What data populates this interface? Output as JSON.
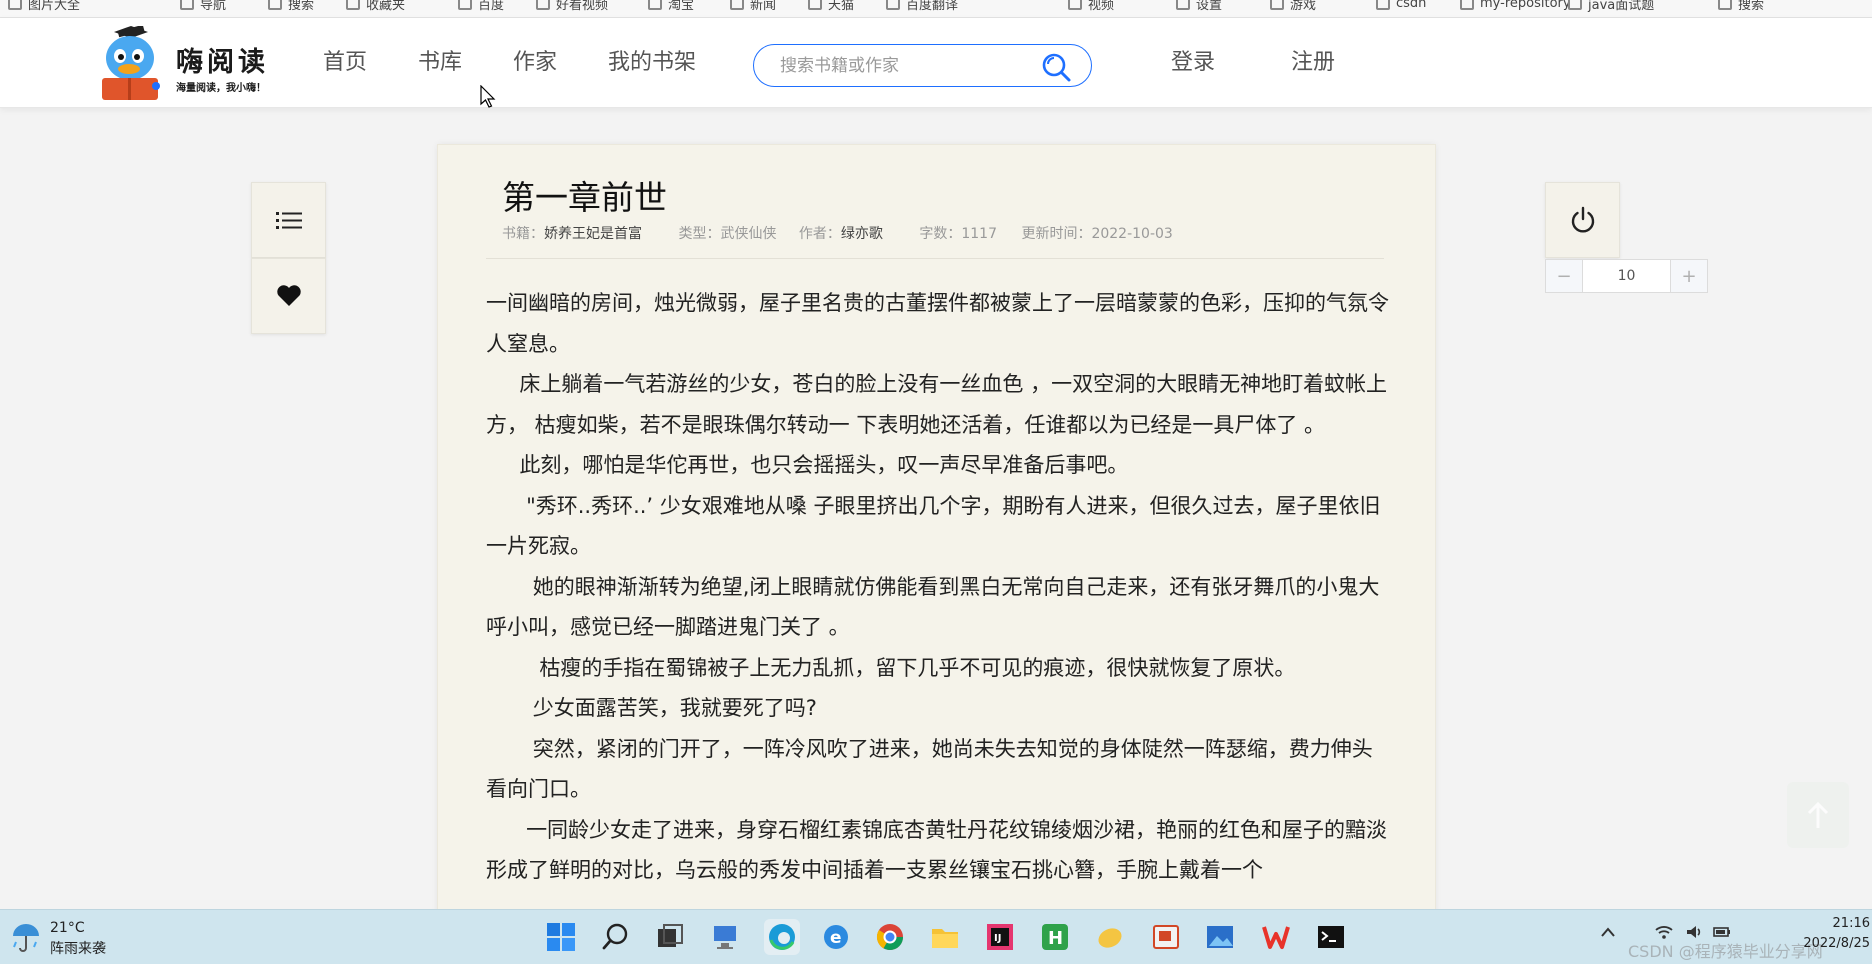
{
  "bookmarks": [
    "图片大全",
    "导航",
    "搜索",
    "收藏夹",
    "百度",
    "好看视频",
    "淘宝",
    "新闻",
    "天猫",
    "百度翻译",
    "视频",
    "设置",
    "游戏",
    "csdn",
    "my-repository",
    "java面试题",
    "搜索"
  ],
  "header": {
    "brand": "嗨阅读",
    "slogan": "海量阅读，我小嗨！",
    "nav": [
      "首页",
      "书库",
      "作家",
      "我的书架"
    ],
    "search_placeholder": "搜索书籍或作家",
    "login": "登录",
    "register": "注册"
  },
  "chapter": {
    "title": "第一章前世",
    "meta": {
      "book_label": "书籍：",
      "book": "娇养王妃是首富",
      "type_label": "类型：",
      "type": "武侠仙侠",
      "author_label": "作者：",
      "author": "绿亦歌",
      "words_label": "字数：",
      "words": "1117",
      "updated_label": "更新时间：",
      "updated": "2022-10-03"
    },
    "paragraphs": [
      "一间幽暗的房间，烛光微弱，屋子里名贵的古董摆件都被蒙上了一层暗蒙蒙的色彩，压抑的气氛令人窒息。",
      "     床上躺着一气若游丝的少女，苍白的脸上没有一丝血色 ，一双空洞的大眼睛无神地盯着蚊帐上方， 枯瘦如柴，若不是眼珠偶尔转动一 下表明她还活着，任谁都以为已经是一具尸体了 。",
      "     此刻，哪怕是华佗再世，也只会摇摇头，叹一声尽早准备后事吧。",
      "      \"秀环..秀环..’ 少女艰难地从嗓 子眼里挤出几个字，期盼有人进来，但很久过去，屋子里依旧一片死寂。",
      "       她的眼神渐渐转为绝望,闭上眼睛就仿佛能看到黑白无常向自己走来，还有张牙舞爪的小鬼大呼小叫，感觉已经一脚踏进鬼门关了 。",
      "        枯瘦的手指在蜀锦被子上无力乱抓，留下几乎不可见的痕迹，很快就恢复了原状。",
      "       少女面露苦笑，我就要死了吗?",
      "       突然，紧闭的门开了，一阵冷风吹了进来，她尚未失去知觉的身体陡然一阵瑟缩，费力伸头看向门口。",
      "      一同龄少女走了进来，身穿石榴红素锦底杏黄牡丹花纹锦绫烟沙裙，艳丽的红色和屋子的黯淡形成了鲜明的对比，乌云般的秀发中间插着一支累丝镶宝石挑心簪，手腕上戴着一个"
    ]
  },
  "reader_controls": {
    "font_size": "10",
    "minus": "−",
    "plus": "+"
  },
  "taskbar": {
    "temperature": "21°C",
    "weather": "阵雨来袭",
    "time": "21:16",
    "date": "2022/8/25",
    "watermark": "CSDN @程序猿毕业分享网"
  },
  "colors": {
    "accent": "#1e6fff",
    "reader_bg": "#f5f3ea",
    "page_bg": "#f3f3f3",
    "taskbar_bg": "#cfe5ee"
  }
}
